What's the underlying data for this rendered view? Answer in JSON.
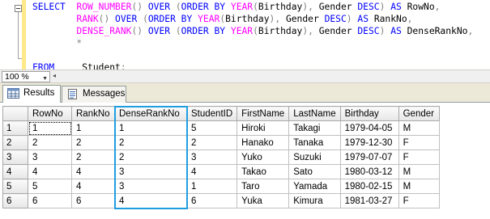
{
  "editor": {
    "lines": [
      [
        {
          "t": "SELECT",
          "c": "k-blue"
        },
        {
          "t": "  ",
          "c": "k-black"
        },
        {
          "t": "ROW_NUMBER",
          "c": "k-mag"
        },
        {
          "t": "()",
          "c": "k-gray"
        },
        {
          "t": " OVER ",
          "c": "k-blue"
        },
        {
          "t": "(",
          "c": "k-gray"
        },
        {
          "t": "ORDER BY ",
          "c": "k-blue"
        },
        {
          "t": "YEAR",
          "c": "k-mag"
        },
        {
          "t": "(",
          "c": "k-gray"
        },
        {
          "t": "Birthday",
          "c": "k-black"
        },
        {
          "t": "),",
          "c": "k-gray"
        },
        {
          "t": " Gender ",
          "c": "k-black"
        },
        {
          "t": "DESC",
          "c": "k-blue"
        },
        {
          "t": ")",
          "c": "k-gray"
        },
        {
          "t": " AS ",
          "c": "k-blue"
        },
        {
          "t": "RowNo",
          "c": "k-black"
        },
        {
          "t": ",",
          "c": "k-gray"
        }
      ],
      [
        {
          "t": "        ",
          "c": "k-black"
        },
        {
          "t": "RANK",
          "c": "k-mag"
        },
        {
          "t": "()",
          "c": "k-gray"
        },
        {
          "t": " OVER ",
          "c": "k-blue"
        },
        {
          "t": "(",
          "c": "k-gray"
        },
        {
          "t": "ORDER BY ",
          "c": "k-blue"
        },
        {
          "t": "YEAR",
          "c": "k-mag"
        },
        {
          "t": "(",
          "c": "k-gray"
        },
        {
          "t": "Birthday",
          "c": "k-black"
        },
        {
          "t": "),",
          "c": "k-gray"
        },
        {
          "t": " Gender ",
          "c": "k-black"
        },
        {
          "t": "DESC",
          "c": "k-blue"
        },
        {
          "t": ")",
          "c": "k-gray"
        },
        {
          "t": " AS ",
          "c": "k-blue"
        },
        {
          "t": "RankNo",
          "c": "k-black"
        },
        {
          "t": ",",
          "c": "k-gray"
        }
      ],
      [
        {
          "t": "        ",
          "c": "k-black"
        },
        {
          "t": "DENSE_RANK",
          "c": "k-mag"
        },
        {
          "t": "()",
          "c": "k-gray"
        },
        {
          "t": " OVER ",
          "c": "k-blue"
        },
        {
          "t": "(",
          "c": "k-gray"
        },
        {
          "t": "ORDER BY ",
          "c": "k-blue"
        },
        {
          "t": "YEAR",
          "c": "k-mag"
        },
        {
          "t": "(",
          "c": "k-gray"
        },
        {
          "t": "Birthday",
          "c": "k-black"
        },
        {
          "t": "),",
          "c": "k-gray"
        },
        {
          "t": " Gender ",
          "c": "k-black"
        },
        {
          "t": "DESC",
          "c": "k-blue"
        },
        {
          "t": ")",
          "c": "k-gray"
        },
        {
          "t": " AS ",
          "c": "k-blue"
        },
        {
          "t": "DenseRankNo",
          "c": "k-black"
        },
        {
          "t": ",",
          "c": "k-gray"
        }
      ],
      [
        {
          "t": "        ",
          "c": "k-black"
        },
        {
          "t": "*",
          "c": "k-gray"
        }
      ],
      [],
      [
        {
          "t": "FROM",
          "c": "k-blue"
        },
        {
          "t": "     ",
          "c": "k-black"
        },
        {
          "t": "Student",
          "c": "k-black"
        },
        {
          "t": ";",
          "c": "k-gray"
        }
      ]
    ]
  },
  "zoom": {
    "value": "100 %"
  },
  "tabs": {
    "results": "Results",
    "messages": "Messages"
  },
  "grid": {
    "columns": [
      "RowNo",
      "RankNo",
      "DenseRankNo",
      "StudentID",
      "FirstName",
      "LastName",
      "Birthday",
      "Gender"
    ],
    "rows": [
      [
        "1",
        "1",
        "1",
        "1",
        "5",
        "Hiroki",
        "Takagi",
        "1979-04-05",
        "M"
      ],
      [
        "2",
        "2",
        "2",
        "2",
        "2",
        "Hanako",
        "Tanaka",
        "1979-12-30",
        "F"
      ],
      [
        "3",
        "3",
        "2",
        "2",
        "3",
        "Yuko",
        "Suzuki",
        "1979-07-07",
        "F"
      ],
      [
        "4",
        "4",
        "4",
        "3",
        "4",
        "Takao",
        "Sato",
        "1980-03-12",
        "M"
      ],
      [
        "5",
        "5",
        "4",
        "3",
        "1",
        "Taro",
        "Yamada",
        "1980-02-15",
        "M"
      ],
      [
        "6",
        "6",
        "6",
        "4",
        "6",
        "Yuka",
        "Kimura",
        "1981-03-27",
        "F"
      ]
    ]
  },
  "colors": {
    "highlight": "#1e9ee0",
    "keyword": "#0000ff",
    "function": "#ff00ff"
  }
}
